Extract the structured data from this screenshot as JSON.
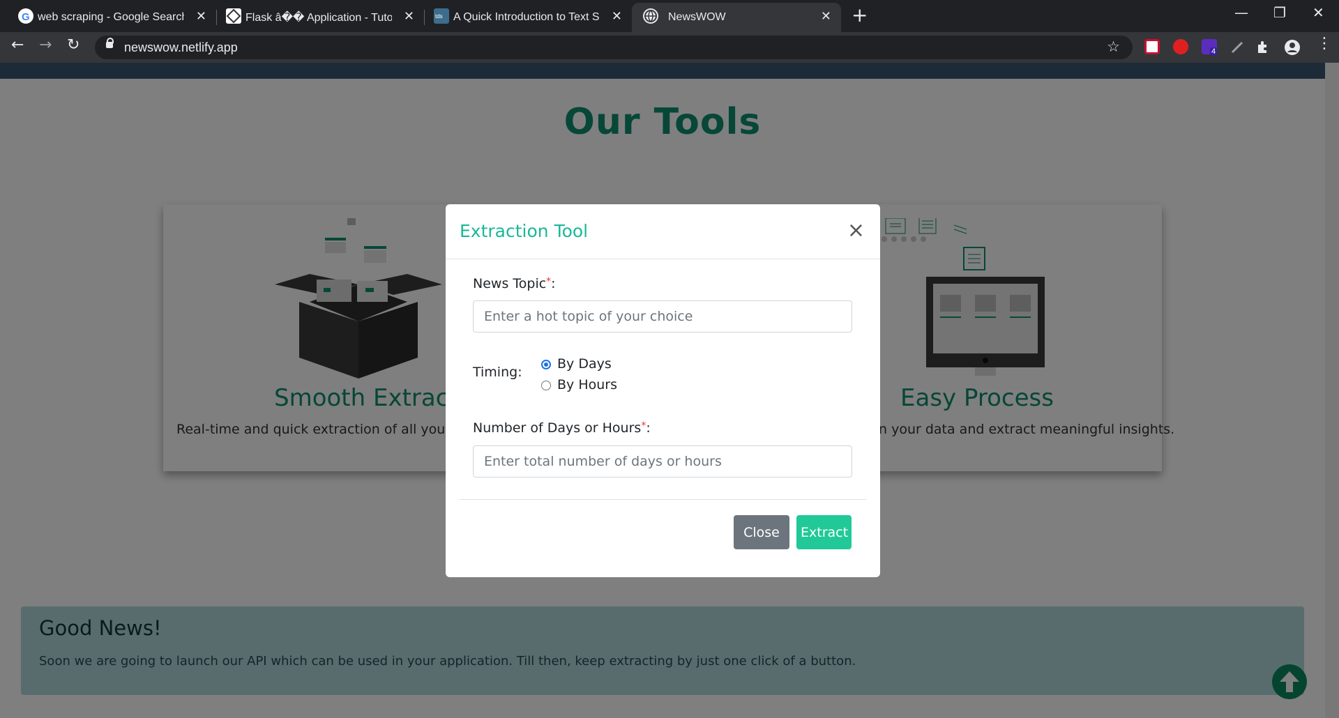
{
  "browser": {
    "tabs": [
      {
        "title": "web scraping - Google Search",
        "icon": "google-icon"
      },
      {
        "title": "Flask â�� Application - Tutorials",
        "icon": "flask-icon"
      },
      {
        "title": "A Quick Introduction to Text Summ",
        "icon": "tds-icon"
      },
      {
        "title": "NewsWOW",
        "icon": "globe-icon"
      }
    ],
    "url": "newswow.netlify.app",
    "extension_badge": "4"
  },
  "page": {
    "heading": "Our  Tools",
    "cards": [
      {
        "title": "Smooth Extract",
        "description": "Real-time and quick extraction of all your da"
      },
      {
        "title": "Easy Process",
        "description": "n your data and extract meaningful insights."
      }
    ],
    "alert": {
      "title": "Good News!",
      "text": "Soon we are going to launch our API which can be used in your application. Till then, keep extracting by just one click of a button."
    }
  },
  "modal": {
    "title": "Extraction Tool",
    "close_symbol": "×",
    "topic_label": "News Topic",
    "topic_placeholder": "Enter a hot topic of your choice",
    "timing_label": "Timing:",
    "timing_options": [
      "By Days",
      "By Hours"
    ],
    "count_label": "Number of Days or Hours",
    "count_placeholder": "Enter total number of days or hours",
    "required_mark": "*",
    "close_button": "Close",
    "extract_button": "Extract"
  },
  "colors": {
    "accent": "#1bb898",
    "heading": "#0e8e6f",
    "close_button": "#6c757d",
    "extract_button": "#20c997",
    "alert_bg": "#b3d9da"
  }
}
